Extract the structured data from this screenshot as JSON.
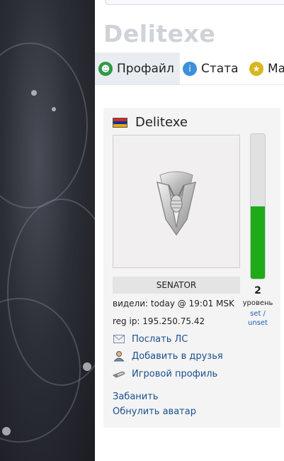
{
  "profile": {
    "name": "Delitexe"
  },
  "tabs": [
    {
      "label": "Профайл",
      "icon": "profile-icon"
    },
    {
      "label": "Стата",
      "icon": "stats-icon"
    },
    {
      "label": "Ма",
      "icon": "medals-icon"
    }
  ],
  "card": {
    "username": "Delitexe",
    "flag_colors": [
      "#d52b1e",
      "#0033a0",
      "#f2a800"
    ],
    "role": "SENATOR",
    "seen": "видели: today @ 19:01 MSK",
    "reg_ip": "reg ip: 195.250.75.42",
    "level": {
      "value": "2",
      "word": "уровень",
      "link": "set / unset",
      "fill": 0.5
    },
    "actions": [
      {
        "label": "Послать ЛС",
        "icon": "envelope-icon"
      },
      {
        "label": "Добавить в друзья",
        "icon": "add-friend-icon"
      },
      {
        "label": "Игровой профиль",
        "icon": "game-profile-icon"
      }
    ],
    "admin_links": {
      "ban": "Забанить",
      "reset_avatar": "Обнулить аватар"
    }
  },
  "colors": {
    "accent": "#1a4f8f",
    "level_fill": "#1faa17",
    "tab_active_bg": "#e9edf1"
  }
}
